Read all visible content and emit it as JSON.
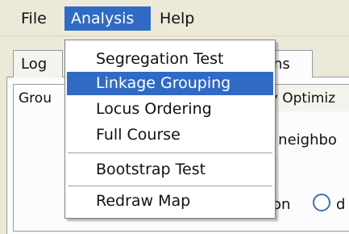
{
  "menubar": {
    "file": "File",
    "analysis": "Analysis",
    "help": "Help"
  },
  "tabs": {
    "log": "Log",
    "options": "ons"
  },
  "subtabs": {
    "group": "Grou",
    "optimize": "ny Optimiz"
  },
  "panel_text": {
    "neighbor": "st neighbo",
    "on": "on",
    "radio_rest": "d"
  },
  "analysis_menu": {
    "items": [
      "Segregation Test",
      "Linkage Grouping",
      "Locus Ordering",
      "Full Course",
      "Bootstrap Test",
      "Redraw Map"
    ],
    "highlighted": "Linkage Grouping"
  },
  "colors": {
    "selection": "#316ac5",
    "window_bg": "#ece9d8",
    "radio_border": "#3f6fb1"
  }
}
